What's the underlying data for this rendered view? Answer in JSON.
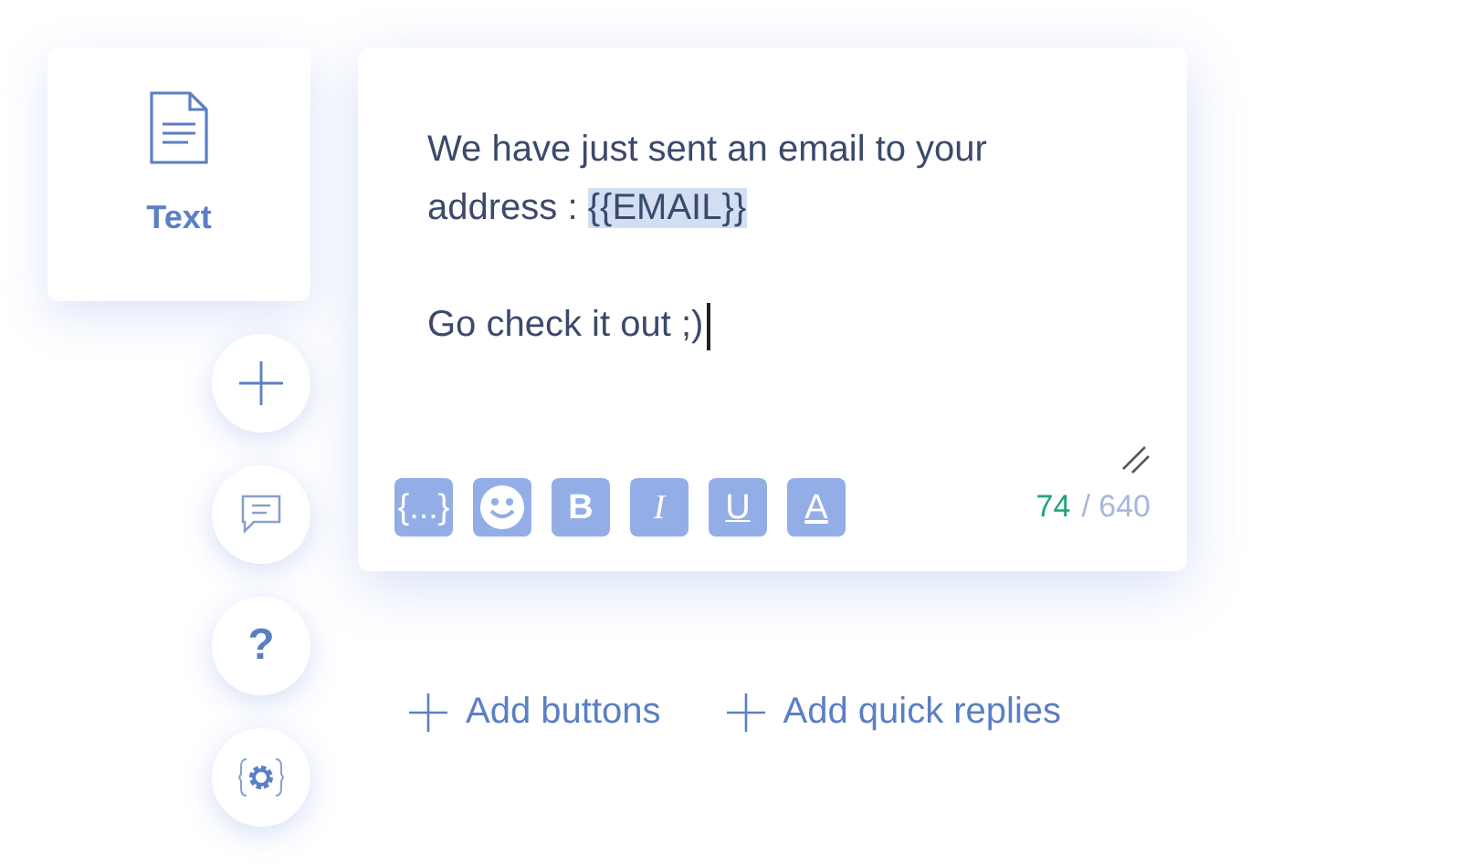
{
  "block": {
    "label": "Text"
  },
  "side_buttons": [
    {
      "kind": "add"
    },
    {
      "kind": "comment"
    },
    {
      "kind": "help",
      "label": "?"
    },
    {
      "kind": "settings"
    }
  ],
  "editor": {
    "paragraphs": [
      {
        "text": "We have just sent an email to your address : ",
        "highlight": "{{EMAIL}}"
      },
      {
        "text": "Go check it out ;)",
        "cursor": true
      }
    ],
    "tools": [
      {
        "kind": "variable",
        "label": "{...}"
      },
      {
        "kind": "emoji"
      },
      {
        "kind": "bold",
        "label": "B"
      },
      {
        "kind": "italic",
        "label": "I"
      },
      {
        "kind": "underline",
        "label": "U"
      },
      {
        "kind": "color",
        "label": "A"
      }
    ],
    "count": "74",
    "limit": "/ 640"
  },
  "actions": [
    {
      "label": "Add buttons"
    },
    {
      "label": "Add quick replies"
    }
  ]
}
